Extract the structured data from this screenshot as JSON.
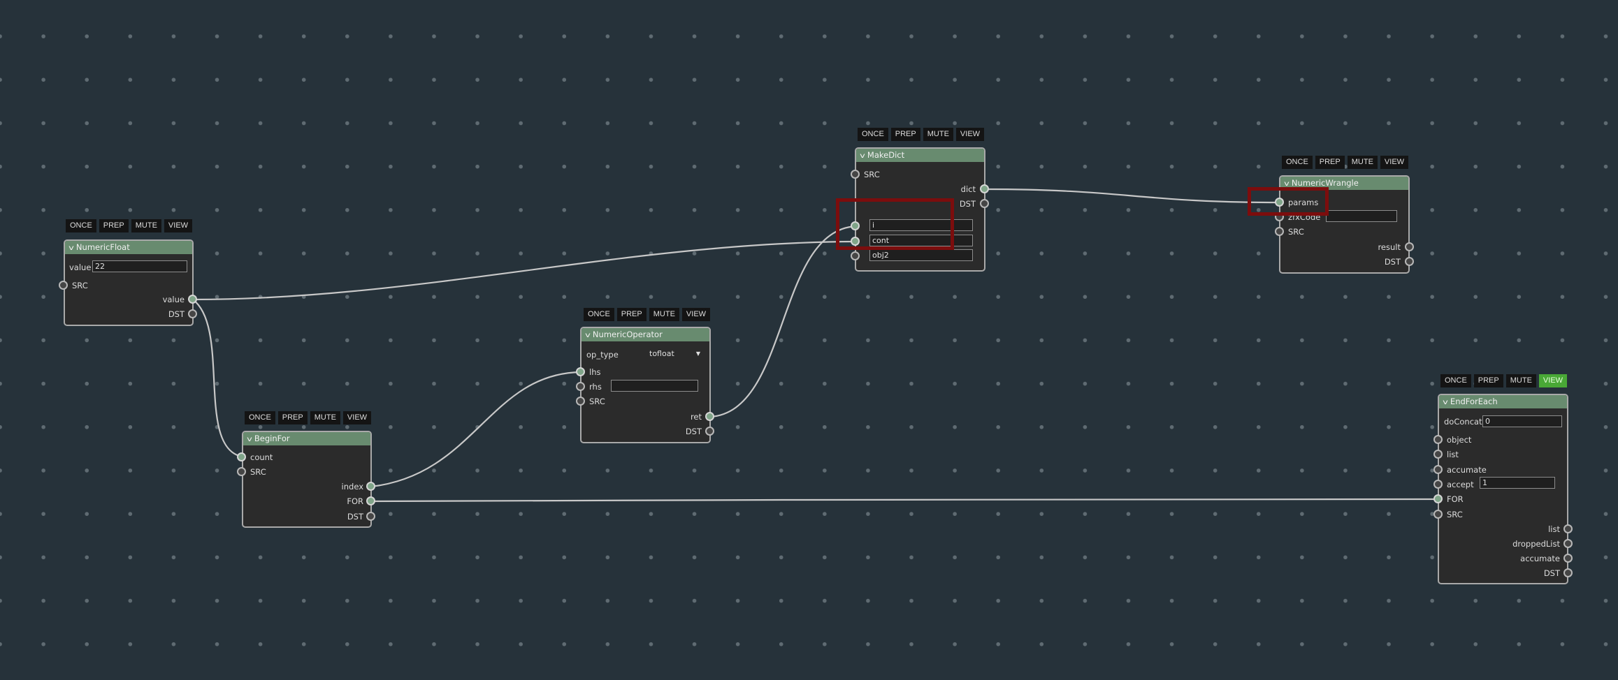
{
  "toolbar_labels": {
    "once": "ONCE",
    "prep": "PREP",
    "mute": "MUTE",
    "view": "VIEW"
  },
  "colors": {
    "background": "#26323a",
    "node_header": "#688b6f",
    "node_body": "#2b2b2b",
    "active_view": "#49a836",
    "highlight": "#7c0d0d",
    "wire": "#c8c8c8"
  },
  "nodes": {
    "numeric_float": {
      "title": "NumericFloat",
      "value_label": "value",
      "value": "22",
      "src": "SRC",
      "out_value": "value",
      "dst": "DST"
    },
    "begin_for": {
      "title": "BeginFor",
      "count": "count",
      "src": "SRC",
      "index": "index",
      "for": "FOR",
      "dst": "DST"
    },
    "numeric_operator": {
      "title": "NumericOperator",
      "op_type_label": "op_type",
      "op_type_value": "tofloat",
      "lhs": "lhs",
      "rhs": "rhs",
      "rhs_value": "",
      "src": "SRC",
      "ret": "ret",
      "dst": "DST"
    },
    "make_dict": {
      "title": "MakeDict",
      "src": "SRC",
      "dict": "dict",
      "dst": "DST",
      "key1": "i",
      "key2": "cont",
      "key3": "obj2"
    },
    "numeric_wrangle": {
      "title": "NumericWrangle",
      "params": "params",
      "zfxcode": "zfxCode",
      "zfxcode_value": "",
      "src": "SRC",
      "result": "result",
      "dst": "DST"
    },
    "end_for_each": {
      "title": "EndForEach",
      "doconcat_label": "doConcat",
      "doconcat_value": "0",
      "object": "object",
      "list_in": "list",
      "accumate_in": "accumate",
      "accept_label": "accept",
      "accept_value": "1",
      "for": "FOR",
      "src": "SRC",
      "list_out": "list",
      "dropped_list": "droppedList",
      "accumate_out": "accumate",
      "dst": "DST",
      "view_active": true
    }
  }
}
